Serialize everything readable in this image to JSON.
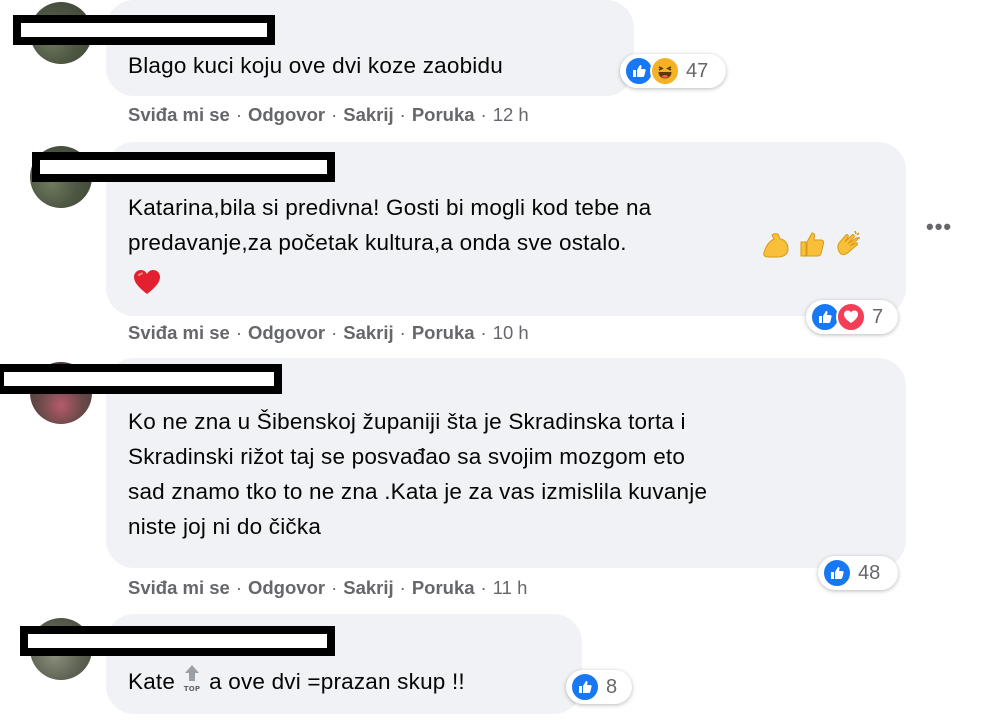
{
  "comments": [
    {
      "text": "Blago kuci koju ove dvi koze zaobidu",
      "reactions": {
        "icons": [
          "like-icon",
          "haha-icon"
        ],
        "count": "47"
      },
      "actions": {
        "like": "Sviđa mi se",
        "reply": "Odgovor",
        "hide": "Sakrij",
        "message": "Poruka",
        "time": "12 h"
      }
    },
    {
      "text": "Katarina,bila si predivna! Gosti bi mogli kod tebe na\npredavanje,za početak kultura,a onda sve ostalo.",
      "emojis": [
        "flexed-biceps-emoji",
        "thumbs-up-emoji",
        "clapping-hands-emoji",
        "red-heart-emoji"
      ],
      "reactions": {
        "icons": [
          "like-icon",
          "love-icon"
        ],
        "count": "7"
      },
      "actions": {
        "like": "Sviđa mi se",
        "reply": "Odgovor",
        "hide": "Sakrij",
        "message": "Poruka",
        "time": "10 h"
      }
    },
    {
      "text": "Ko ne zna u Šibenskoj županiji šta je Skradinska torta i\nSkradinski rižot taj se posvađao sa svojim mozgom eto\nsad znamo tko to ne zna .Kata je za vas izmislila kuvanje\nniste joj ni do čička",
      "reactions": {
        "icons": [
          "like-icon"
        ],
        "count": "48"
      },
      "actions": {
        "like": "Sviđa mi se",
        "reply": "Odgovor",
        "hide": "Sakrij",
        "message": "Poruka",
        "time": "11 h"
      }
    },
    {
      "text_before": "Kate",
      "emoji": "top-arrow-emoji",
      "text_after": "a ove dvi =prazan skup !!",
      "reactions": {
        "icons": [
          "like-icon"
        ],
        "count": "8"
      }
    }
  ],
  "more_options": "•••",
  "colors": {
    "like": "#1877f2",
    "love": "#f33e58",
    "haha": "#f7b125",
    "bubble": "#f0f2f5",
    "secondary_text": "#65676b"
  }
}
